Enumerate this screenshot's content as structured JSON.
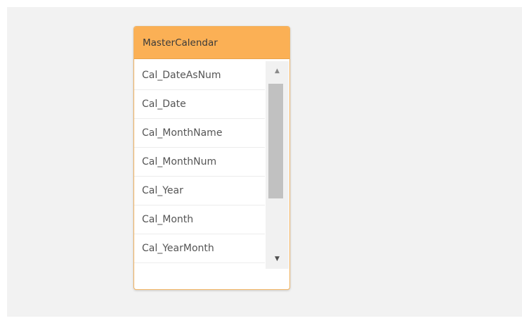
{
  "table": {
    "name": "MasterCalendar",
    "fields": [
      "Cal_DateAsNum",
      "Cal_Date",
      "Cal_MonthName",
      "Cal_MonthNum",
      "Cal_Year",
      "Cal_Month",
      "Cal_YearMonth"
    ]
  },
  "scrollbar": {
    "up_icon": "▲",
    "down_icon": "▼",
    "scroll_position_fraction": 0.0,
    "visible_fraction": 0.55
  },
  "colors": {
    "header_background": "#fbb055",
    "card_border": "#f0b260",
    "canvas_background": "#f2f2f2",
    "scroll_thumb": "#c1c1c1"
  }
}
